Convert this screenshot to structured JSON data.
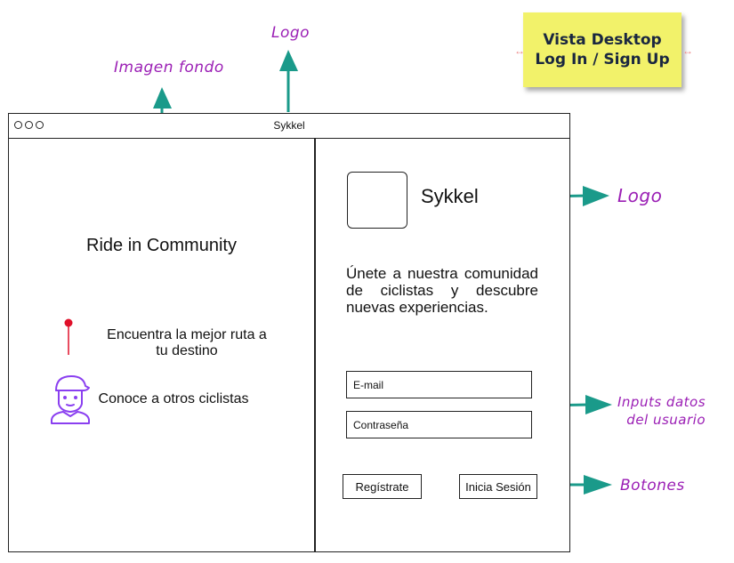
{
  "annotations": {
    "background_image": "Imagen fondo",
    "logo_top": "Logo",
    "logo_right": "Logo",
    "inputs": [
      "Inputs datos",
      "del usuario"
    ],
    "buttons": "Botones"
  },
  "sticky_note": {
    "line1": "Vista Desktop",
    "line2": "Log In / Sign Up"
  },
  "window": {
    "title": "Sykkel"
  },
  "left_panel": {
    "title": "Ride in Community",
    "features": [
      {
        "icon": "map-pin-icon",
        "text_line1": "Encuentra la mejor ruta a",
        "text_line2": "tu destino"
      },
      {
        "icon": "cyclist-avatar-icon",
        "text_line1": "Conoce a otros ciclistas"
      }
    ]
  },
  "right_panel": {
    "app_name": "Sykkel",
    "intro": "Únete a nuestra comunidad de ciclistas y descubre nuevas experiencias.",
    "email_placeholder": "E-mail",
    "password_placeholder": "Contraseña",
    "register_label": "Regístrate",
    "login_label": "Inicia Sesión"
  },
  "colors": {
    "annotation": "#9b1fb5",
    "arrow": "#1a9a8a",
    "sticky": "#f2f26a",
    "pin": "#e0102a",
    "avatar": "#8a3ff0"
  }
}
